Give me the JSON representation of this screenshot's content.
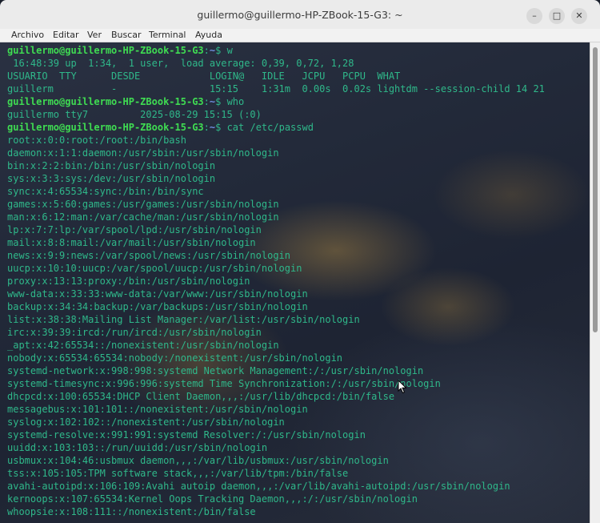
{
  "window": {
    "title": "guillermo@guillermo-HP-ZBook-15-G3: ~",
    "minimize_glyph": "–",
    "maximize_glyph": "□",
    "close_glyph": "✕"
  },
  "menu": [
    "Archivo",
    "Editar",
    "Ver",
    "Buscar",
    "Terminal",
    "Ayuda"
  ],
  "prompt": {
    "user_host": "guillermo@guillermo-HP-ZBook-15-G3",
    "path": "~",
    "symbol": "$"
  },
  "terminal_lines": [
    {
      "type": "prompt",
      "cmd": " w"
    },
    {
      "type": "out",
      "text": " 16:48:39 up  1:34,  1 user,  load average: 0,39, 0,72, 1,28"
    },
    {
      "type": "out",
      "text": "USUARIO  TTY      DESDE            LOGIN@   IDLE   JCPU   PCPU  WHAT"
    },
    {
      "type": "out",
      "text": "guillerm          -                15:15    1:31m  0.00s  0.02s lightdm --session-child 14 21"
    },
    {
      "type": "prompt",
      "cmd": " who"
    },
    {
      "type": "out",
      "text": "guillermo tty7         2025-08-29 15:15 (:0)"
    },
    {
      "type": "prompt",
      "cmd": " cat /etc/passwd"
    },
    {
      "type": "out",
      "text": "root:x:0:0:root:/root:/bin/bash"
    },
    {
      "type": "out",
      "text": "daemon:x:1:1:daemon:/usr/sbin:/usr/sbin/nologin"
    },
    {
      "type": "out",
      "text": "bin:x:2:2:bin:/bin:/usr/sbin/nologin"
    },
    {
      "type": "out",
      "text": "sys:x:3:3:sys:/dev:/usr/sbin/nologin"
    },
    {
      "type": "out",
      "text": "sync:x:4:65534:sync:/bin:/bin/sync"
    },
    {
      "type": "out",
      "text": "games:x:5:60:games:/usr/games:/usr/sbin/nologin"
    },
    {
      "type": "out",
      "text": "man:x:6:12:man:/var/cache/man:/usr/sbin/nologin"
    },
    {
      "type": "out",
      "text": "lp:x:7:7:lp:/var/spool/lpd:/usr/sbin/nologin"
    },
    {
      "type": "out",
      "text": "mail:x:8:8:mail:/var/mail:/usr/sbin/nologin"
    },
    {
      "type": "out",
      "text": "news:x:9:9:news:/var/spool/news:/usr/sbin/nologin"
    },
    {
      "type": "out",
      "text": "uucp:x:10:10:uucp:/var/spool/uucp:/usr/sbin/nologin"
    },
    {
      "type": "out",
      "text": "proxy:x:13:13:proxy:/bin:/usr/sbin/nologin"
    },
    {
      "type": "out",
      "text": "www-data:x:33:33:www-data:/var/www:/usr/sbin/nologin"
    },
    {
      "type": "out",
      "text": "backup:x:34:34:backup:/var/backups:/usr/sbin/nologin"
    },
    {
      "type": "out",
      "text": "list:x:38:38:Mailing List Manager:/var/list:/usr/sbin/nologin"
    },
    {
      "type": "out",
      "text": "irc:x:39:39:ircd:/run/ircd:/usr/sbin/nologin"
    },
    {
      "type": "out",
      "text": "_apt:x:42:65534::/nonexistent:/usr/sbin/nologin"
    },
    {
      "type": "out",
      "text": "nobody:x:65534:65534:nobody:/nonexistent:/usr/sbin/nologin"
    },
    {
      "type": "out",
      "text": "systemd-network:x:998:998:systemd Network Management:/:/usr/sbin/nologin"
    },
    {
      "type": "out",
      "text": "systemd-timesync:x:996:996:systemd Time Synchronization:/:/usr/sbin/nologin"
    },
    {
      "type": "out",
      "text": "dhcpcd:x:100:65534:DHCP Client Daemon,,,:/usr/lib/dhcpcd:/bin/false"
    },
    {
      "type": "out",
      "text": "messagebus:x:101:101::/nonexistent:/usr/sbin/nologin"
    },
    {
      "type": "out",
      "text": "syslog:x:102:102::/nonexistent:/usr/sbin/nologin"
    },
    {
      "type": "out",
      "text": "systemd-resolve:x:991:991:systemd Resolver:/:/usr/sbin/nologin"
    },
    {
      "type": "out",
      "text": "uuidd:x:103:103::/run/uuidd:/usr/sbin/nologin"
    },
    {
      "type": "out",
      "text": "usbmux:x:104:46:usbmux daemon,,,:/var/lib/usbmux:/usr/sbin/nologin"
    },
    {
      "type": "out",
      "text": "tss:x:105:105:TPM software stack,,,:/var/lib/tpm:/bin/false"
    },
    {
      "type": "out",
      "text": "avahi-autoipd:x:106:109:Avahi autoip daemon,,,:/var/lib/avahi-autoipd:/usr/sbin/nologin"
    },
    {
      "type": "out",
      "text": "kernoops:x:107:65534:Kernel Oops Tracking Daemon,,,:/:/usr/sbin/nologin"
    },
    {
      "type": "out",
      "text": "whoopsie:x:108:111::/nonexistent:/bin/false"
    }
  ]
}
